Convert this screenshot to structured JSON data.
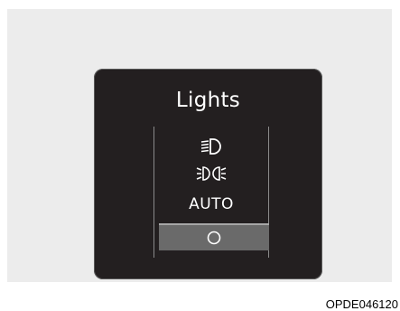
{
  "display": {
    "title": "Lights",
    "options": [
      {
        "name": "low-beam",
        "icon": "low-beam-headlamp-icon"
      },
      {
        "name": "position-lamp",
        "icon": "position-lamp-icon"
      },
      {
        "name": "auto",
        "label": "AUTO"
      },
      {
        "name": "off",
        "icon": "off-circle-icon",
        "selected": true
      }
    ]
  },
  "caption": "OPDE046120",
  "colors": {
    "background": "#ececec",
    "display": "#231f20",
    "selected": "#6a6a6a",
    "text": "#ffffff"
  }
}
